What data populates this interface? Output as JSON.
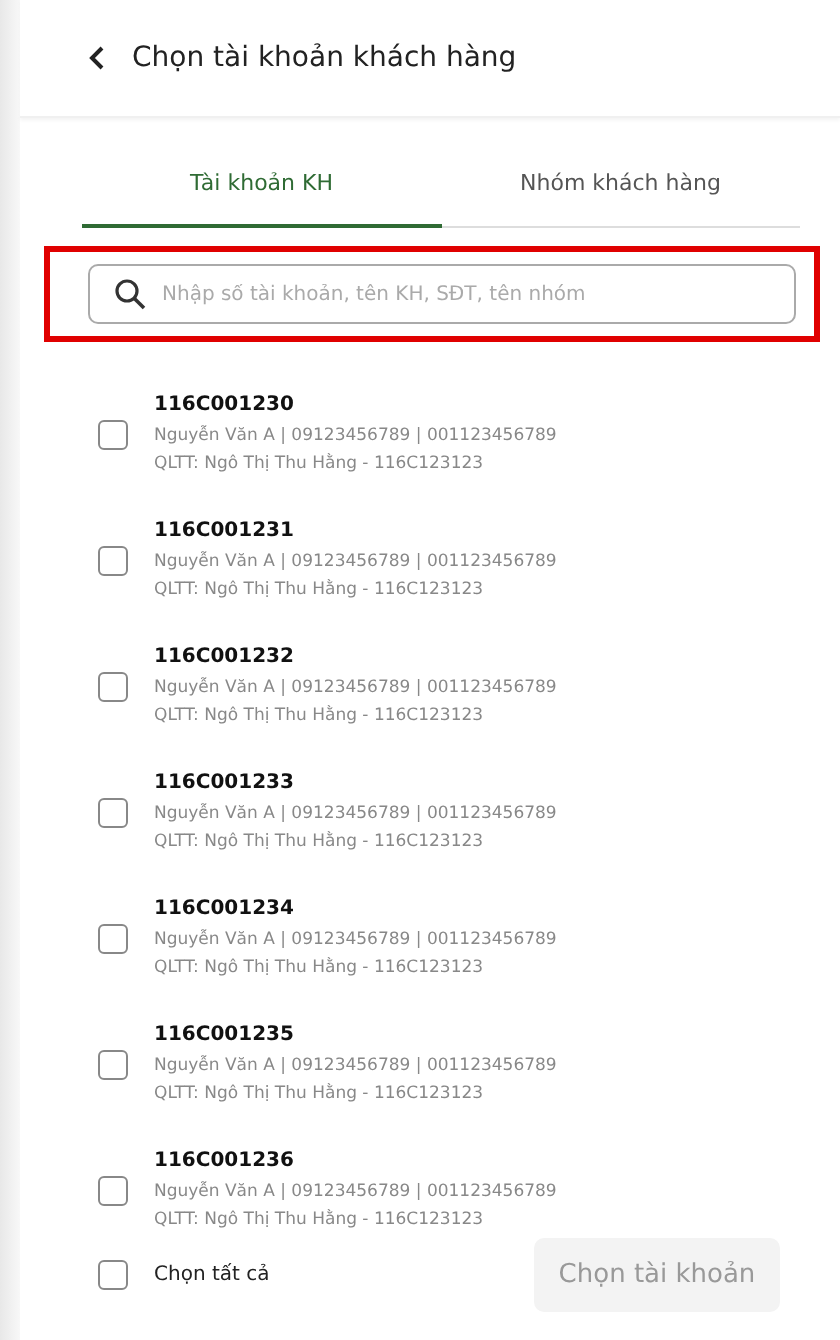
{
  "header": {
    "title": "Chọn tài khoản khách hàng"
  },
  "tabs": [
    {
      "label": "Tài khoản KH",
      "selected": true
    },
    {
      "label": "Nhóm khách hàng",
      "selected": false
    }
  ],
  "search": {
    "placeholder": "Nhập số tài khoản, tên KH, SĐT, tên nhóm",
    "highlighted": true
  },
  "accounts": [
    {
      "number": "116C001230",
      "details": "Nguyễn Văn A | 09123456789 | 001123456789",
      "manager": "QLTT: Ngô Thị Thu Hằng - 116C123123",
      "checked": false
    },
    {
      "number": "116C001231",
      "details": "Nguyễn Văn A | 09123456789 | 001123456789",
      "manager": "QLTT: Ngô Thị Thu Hằng - 116C123123",
      "checked": false
    },
    {
      "number": "116C001232",
      "details": "Nguyễn Văn A | 09123456789 | 001123456789",
      "manager": "QLTT: Ngô Thị Thu Hằng - 116C123123",
      "checked": false
    },
    {
      "number": "116C001233",
      "details": "Nguyễn Văn A | 09123456789 | 001123456789",
      "manager": "QLTT: Ngô Thị Thu Hằng - 116C123123",
      "checked": false
    },
    {
      "number": "116C001234",
      "details": "Nguyễn Văn A | 09123456789 | 001123456789",
      "manager": "QLTT: Ngô Thị Thu Hằng - 116C123123",
      "checked": false
    },
    {
      "number": "116C001235",
      "details": "Nguyễn Văn A | 09123456789 | 001123456789",
      "manager": "QLTT: Ngô Thị Thu Hằng - 116C123123",
      "checked": false
    },
    {
      "number": "116C001236",
      "details": "Nguyễn Văn A | 09123456789 | 001123456789",
      "manager": "QLTT: Ngô Thị Thu Hằng - 116C123123",
      "checked": false
    }
  ],
  "footer": {
    "select_all": {
      "label": "Chọn tất cả",
      "checked": false
    },
    "confirm_button": {
      "label": "Chọn tài khoản",
      "disabled": true
    }
  }
}
